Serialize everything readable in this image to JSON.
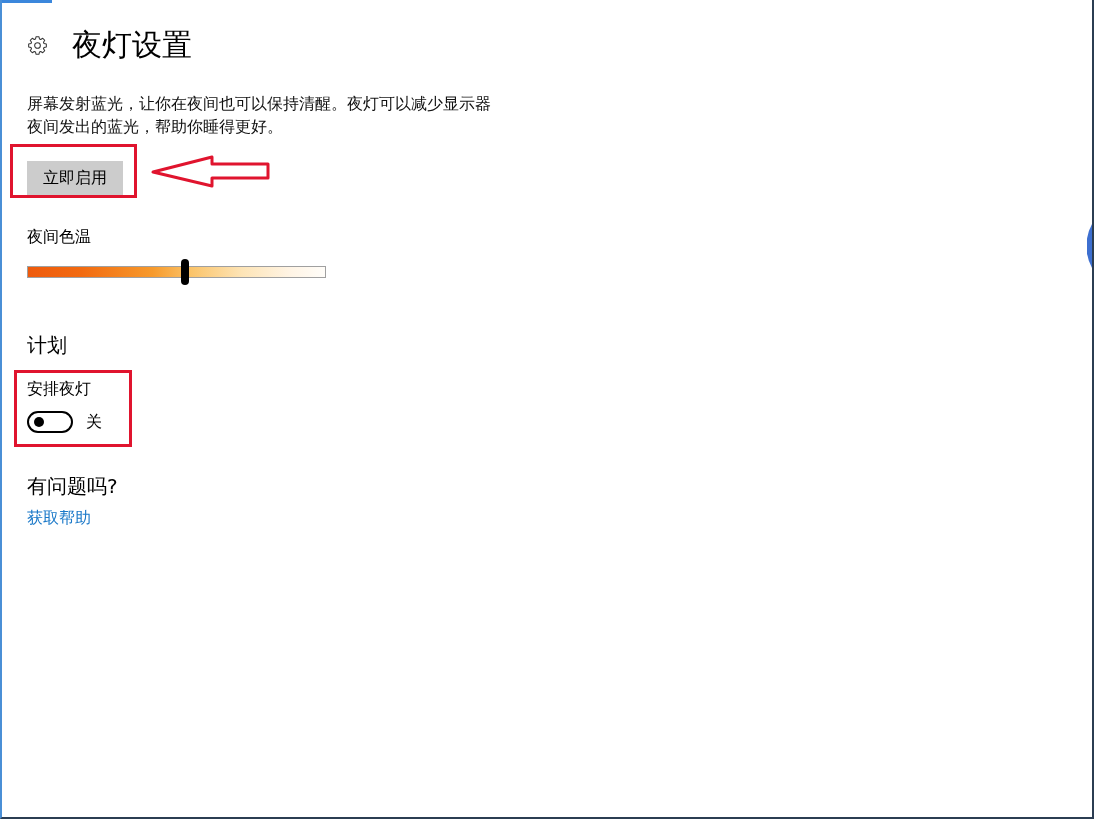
{
  "window": {
    "title": "夜灯设置"
  },
  "intro": {
    "description": "屏幕发射蓝光，让你在夜间也可以保持清醒。夜灯可以减少显示器夜间发出的蓝光，帮助你睡得更好。"
  },
  "enable_button": {
    "label": "立即启用"
  },
  "color_temperature": {
    "label": "夜间色温",
    "level": 0.53
  },
  "schedule": {
    "heading": "计划",
    "toggle": {
      "label": "安排夜灯",
      "on": false,
      "state_text": "关"
    }
  },
  "help": {
    "heading": "有问题吗?",
    "link": "获取帮助"
  }
}
